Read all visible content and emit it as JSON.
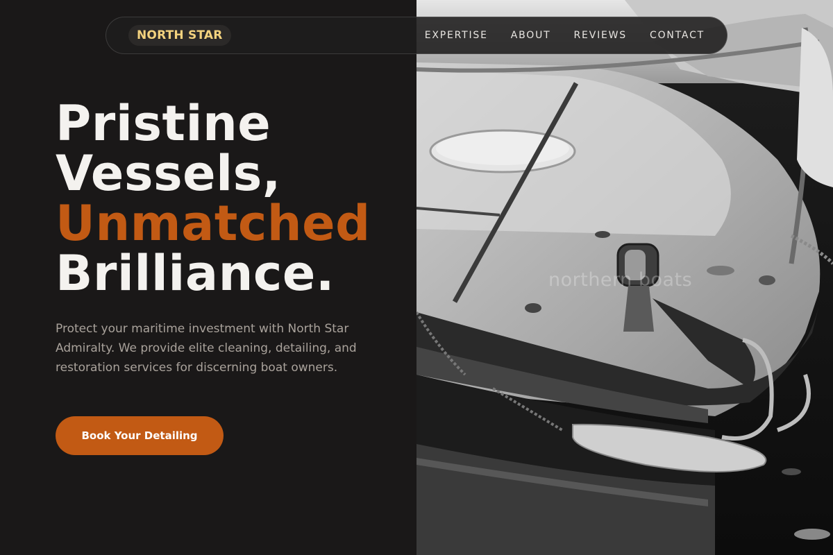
{
  "brand": {
    "name": "NORTH STAR",
    "color": "#f3d27e"
  },
  "nav": {
    "links": [
      {
        "label": "EXPERTISE"
      },
      {
        "label": "ABOUT"
      },
      {
        "label": "REVIEWS"
      },
      {
        "label": "CONTACT"
      }
    ]
  },
  "hero": {
    "line1": "Pristine",
    "line2": "Vessels,",
    "line3_accent": "Unmatched",
    "line4": "Brilliance.",
    "description": "Protect your maritime investment with North Star Admiralty. We provide elite cleaning, detailing, and restoration services for discerning boat owners.",
    "cta_label": "Book Your Detailing"
  },
  "photo": {
    "watermark": "northern boats"
  },
  "colors": {
    "background": "#1a1818",
    "accent": "#c25a14",
    "heading": "#f4f2ef",
    "body_text": "#a9a29b"
  }
}
